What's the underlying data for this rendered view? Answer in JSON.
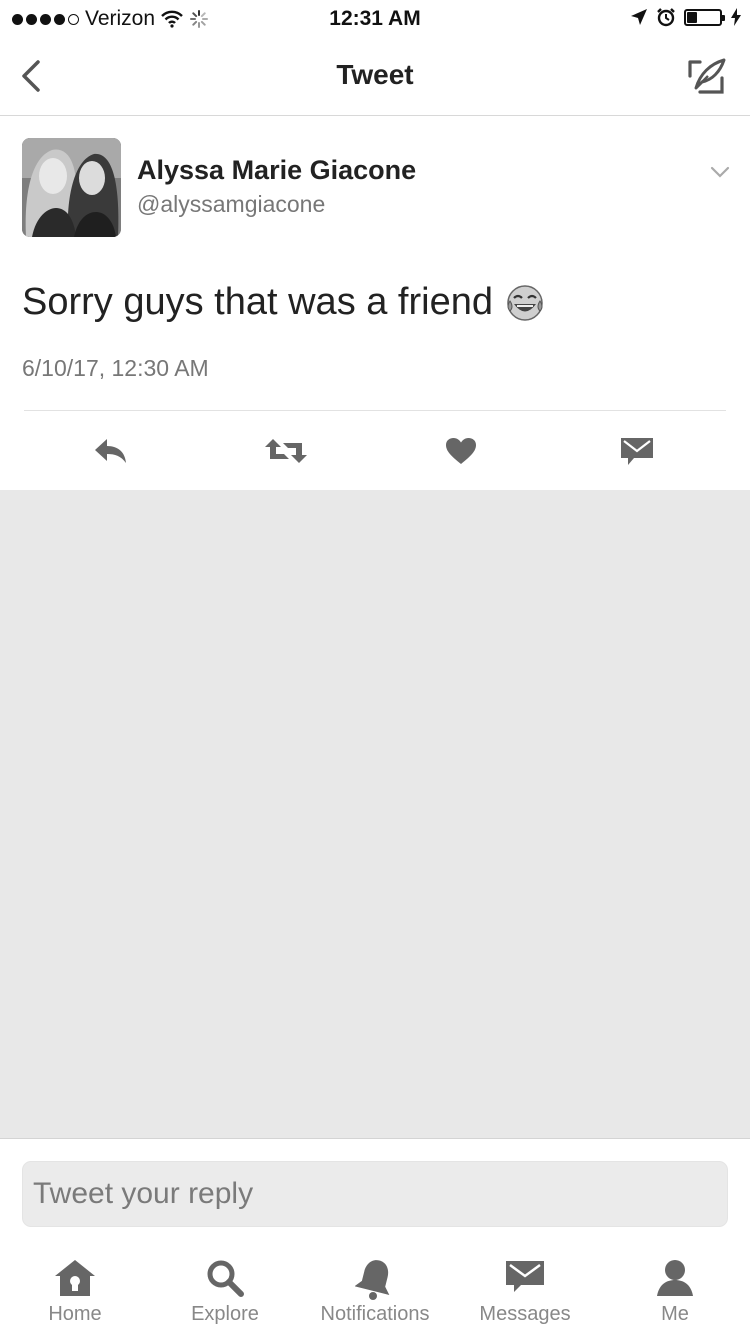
{
  "status_bar": {
    "carrier": "Verizon",
    "time": "12:31 AM",
    "signal_dots_filled": 4,
    "signal_dots_total": 5,
    "battery_level": 0.3
  },
  "nav": {
    "title": "Tweet"
  },
  "tweet": {
    "author_name": "Alyssa Marie Giacone",
    "author_handle": "@alyssamgiacone",
    "text": "Sorry guys that was a friend",
    "emoji": "face-with-tears-of-joy",
    "timestamp": "6/10/17, 12:30 AM"
  },
  "actions": {
    "icons": [
      "reply-icon",
      "retweet-icon",
      "like-icon",
      "direct-message-icon"
    ]
  },
  "reply": {
    "placeholder": "Tweet your reply"
  },
  "tab_bar": {
    "tabs": [
      {
        "label": "Home",
        "icon": "home-icon"
      },
      {
        "label": "Explore",
        "icon": "search-icon"
      },
      {
        "label": "Notifications",
        "icon": "bell-icon"
      },
      {
        "label": "Messages",
        "icon": "envelope-icon"
      },
      {
        "label": "Me",
        "icon": "person-icon"
      }
    ]
  },
  "colors": {
    "background": "#ffffff",
    "content_gray": "#e8e8e8",
    "text_primary": "#222222",
    "text_secondary": "#777777",
    "icon_gray": "#666666"
  }
}
